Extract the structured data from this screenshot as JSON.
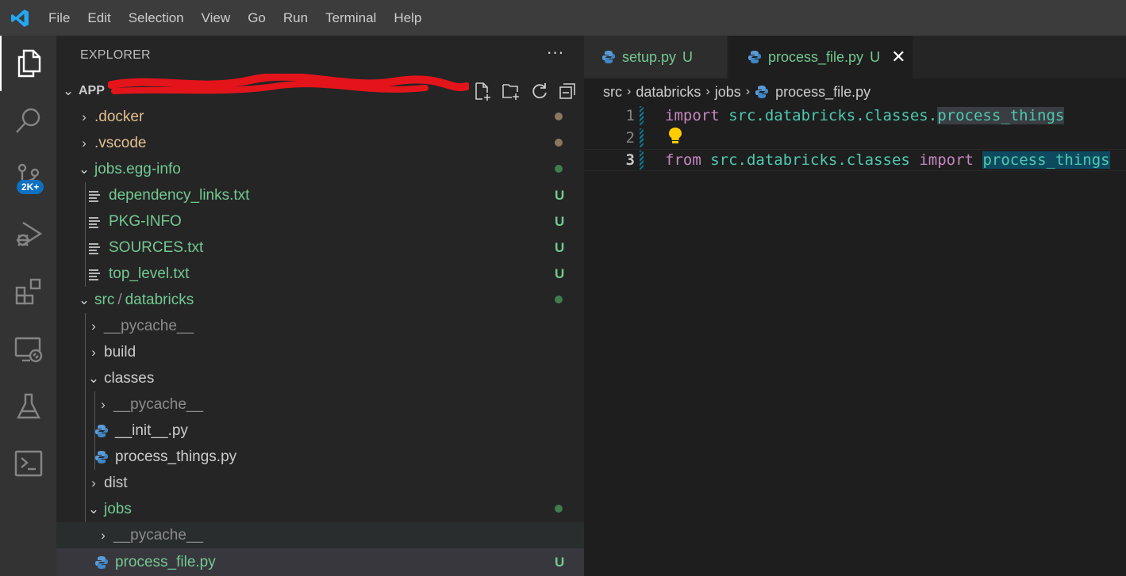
{
  "menu": [
    "File",
    "Edit",
    "Selection",
    "View",
    "Go",
    "Run",
    "Terminal",
    "Help"
  ],
  "activity": {
    "scm_badge": "2K+"
  },
  "explorer": {
    "title": "EXPLORER",
    "more": "···",
    "root_label": "APP",
    "tree": [
      {
        "label": ".docker",
        "status": ""
      },
      {
        "label": ".vscode",
        "status": ""
      },
      {
        "label": "jobs.egg-info",
        "status": ""
      },
      {
        "label": "dependency_links.txt",
        "status": "U"
      },
      {
        "label": "PKG-INFO",
        "status": "U"
      },
      {
        "label": "SOURCES.txt",
        "status": "U"
      },
      {
        "label": "top_level.txt",
        "status": "U"
      },
      {
        "label": "src",
        "label2": "databricks",
        "status": ""
      },
      {
        "label": "__pycache__",
        "status": ""
      },
      {
        "label": "build",
        "status": ""
      },
      {
        "label": "classes",
        "status": ""
      },
      {
        "label": "__pycache__",
        "status": ""
      },
      {
        "label": "__init__.py",
        "status": ""
      },
      {
        "label": "process_things.py",
        "status": ""
      },
      {
        "label": "dist",
        "status": ""
      },
      {
        "label": "jobs",
        "status": ""
      },
      {
        "label": "__pycache__",
        "status": ""
      },
      {
        "label": "process_file.py",
        "status": "U"
      }
    ],
    "colors": {
      "untracked": "#73c991",
      "modified_dot": "#8a7760",
      "green_dot": "#3f7d4f"
    }
  },
  "tabs": [
    {
      "label": "setup.py",
      "status": "U"
    },
    {
      "label": "process_file.py",
      "status": "U",
      "close": "✕"
    }
  ],
  "breadcrumb": [
    "src",
    "databricks",
    "jobs",
    "process_file.py"
  ],
  "editor": {
    "lines": [
      {
        "num": "1",
        "kw": "import",
        "mod": "src.databricks.classes.",
        "hl": "process_things"
      },
      {
        "num": "2"
      },
      {
        "num": "3",
        "kw": "from",
        "mod": "src.databricks.classes",
        "kw2": "import",
        "hl": "process_things"
      }
    ]
  }
}
